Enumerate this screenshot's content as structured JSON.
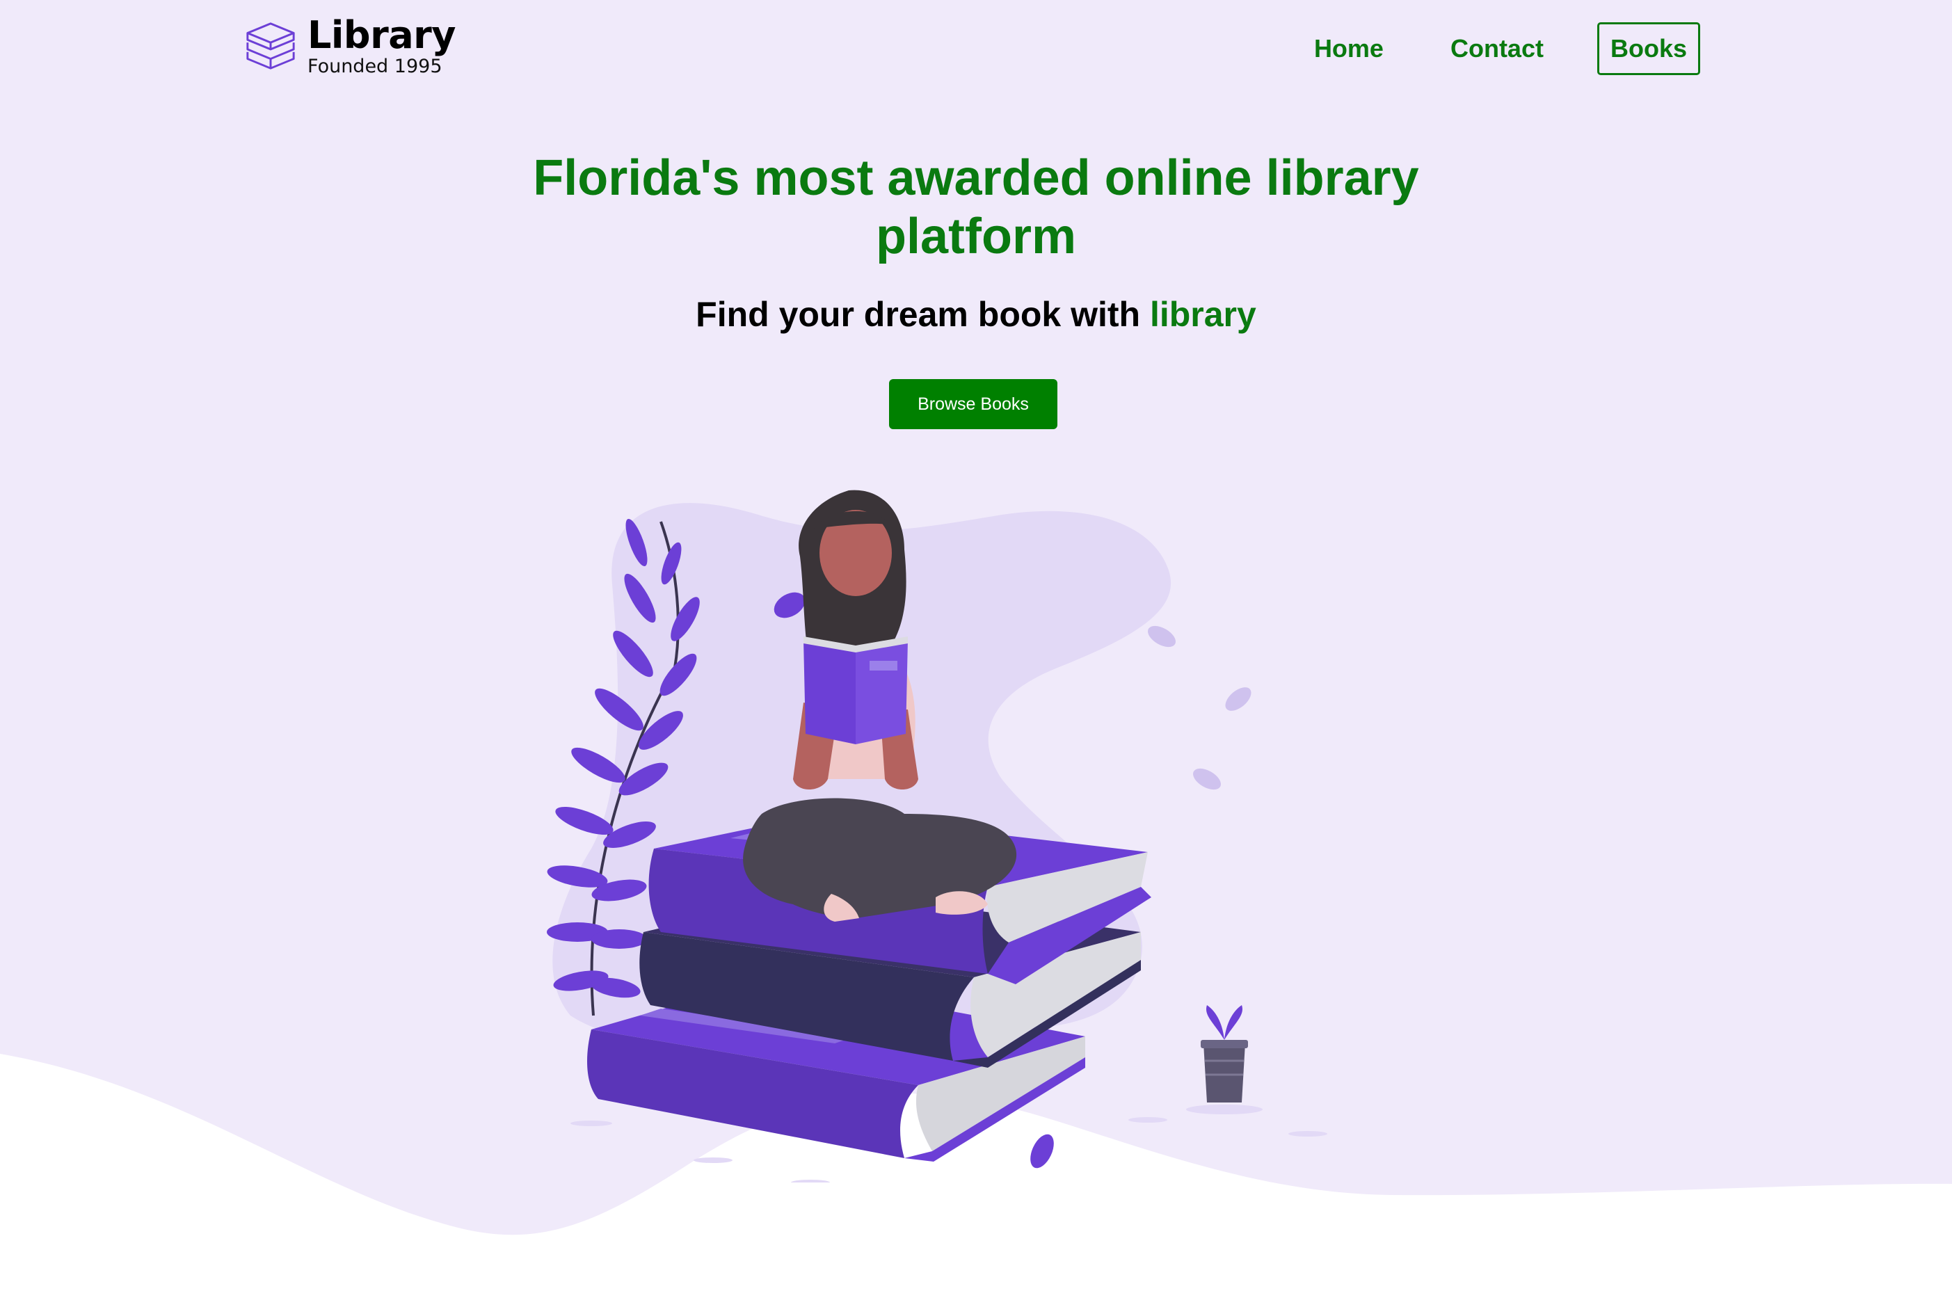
{
  "header": {
    "logo_title": "Library",
    "logo_subtitle": "Founded 1995",
    "logo_icon": "stacked-books-icon",
    "nav": [
      {
        "label": "Home",
        "active": false
      },
      {
        "label": "Contact",
        "active": false
      },
      {
        "label": "Books",
        "active": true
      }
    ]
  },
  "hero": {
    "title": "Florida's most awarded online library platform",
    "subtitle_prefix": "Find your dream book with ",
    "subtitle_accent": "library",
    "cta_label": "Browse Books"
  },
  "illustration": "woman-reading-on-books-illustration",
  "colors": {
    "brand_green": "#0a7a10",
    "button_green": "#008000",
    "background_lavender": "#f0eafa",
    "blob_lavender": "#e2d9f6",
    "accent_purple": "#6c3fd6"
  }
}
